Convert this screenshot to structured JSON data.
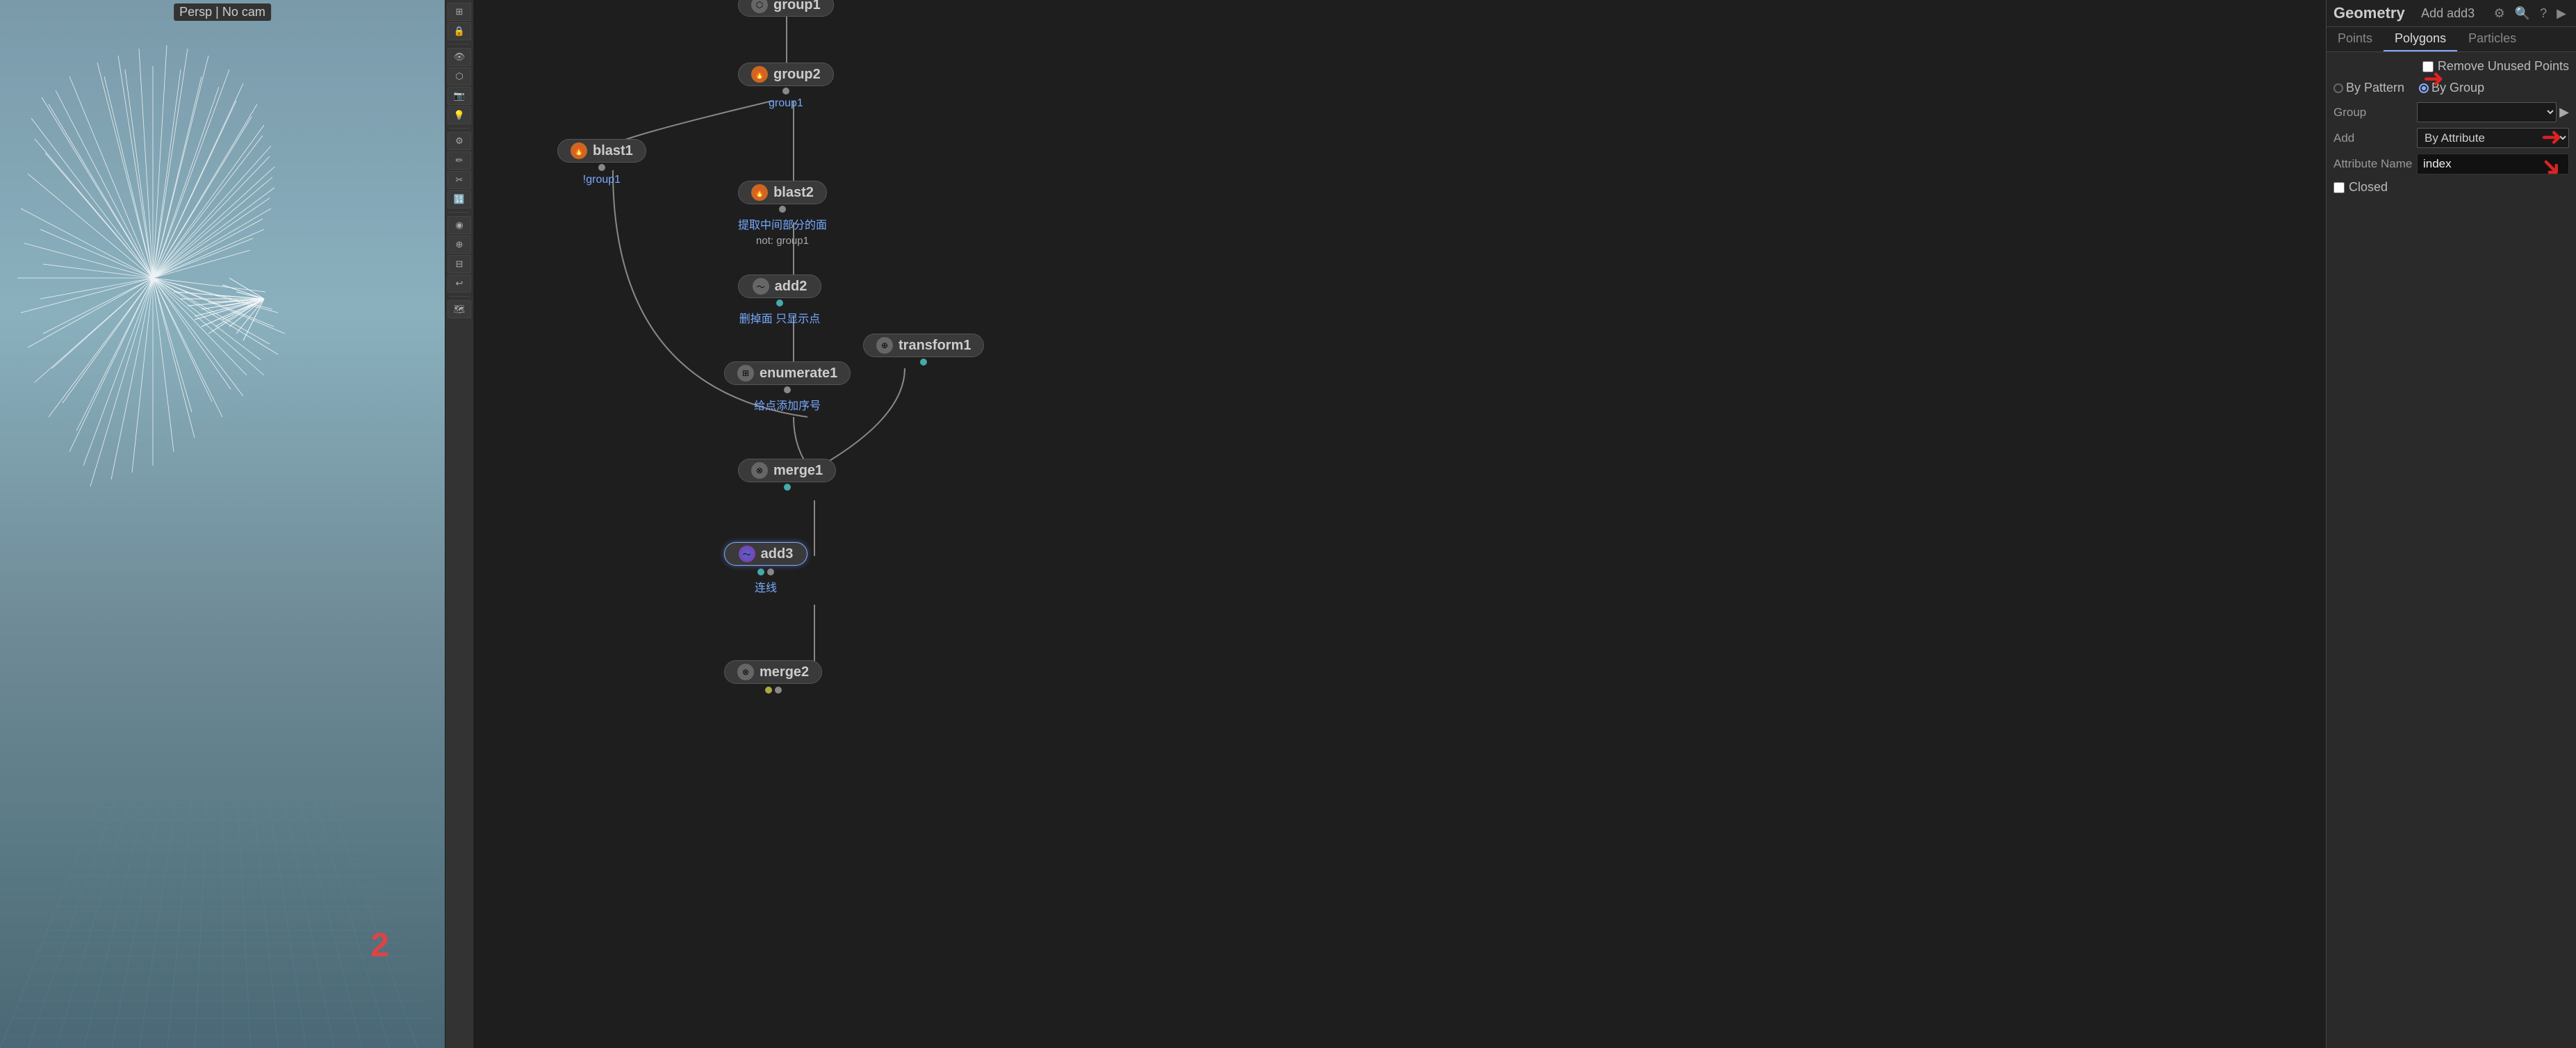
{
  "viewport": {
    "label": "Persp | No cam",
    "number": "2"
  },
  "toolbar": {
    "buttons": [
      {
        "icon": "⊞",
        "name": "layout-icon"
      },
      {
        "icon": "🔒",
        "name": "lock-icon"
      },
      {
        "icon": "👁",
        "name": "eye-icon"
      },
      {
        "icon": "⬡",
        "name": "geo-icon"
      },
      {
        "icon": "📷",
        "name": "cam-icon"
      },
      {
        "icon": "💡",
        "name": "light-icon"
      },
      {
        "icon": "⚙",
        "name": "settings-icon"
      },
      {
        "icon": "✏",
        "name": "edit-icon"
      },
      {
        "icon": "✂",
        "name": "cut-icon"
      },
      {
        "icon": "🔢",
        "name": "num-icon"
      },
      {
        "icon": "◉",
        "name": "dot-icon"
      },
      {
        "icon": "⊕",
        "name": "plus-icon"
      },
      {
        "icon": "⊟",
        "name": "minus-icon"
      },
      {
        "icon": "↩",
        "name": "undo-icon"
      },
      {
        "icon": "🗺",
        "name": "map-icon"
      }
    ]
  },
  "nodes": {
    "group1_top": {
      "label": "group1",
      "sublabel": "",
      "type": "gray"
    },
    "group2": {
      "label": "group2",
      "sublabel": "group1",
      "type": "orange"
    },
    "blast1": {
      "label": "blast1",
      "sublabel": "!group1",
      "type": "orange"
    },
    "blast2": {
      "label": "blast2",
      "sublabel": "提取中间部分的面",
      "type": "orange"
    },
    "add2": {
      "label": "add2",
      "sublabel": "删掉面 只显示点",
      "type": "gray"
    },
    "enumerate1": {
      "label": "enumerate1",
      "sublabel": "给点添加序号",
      "type": "gray"
    },
    "transform1": {
      "label": "transform1",
      "sublabel": "",
      "type": "gray"
    },
    "merge1": {
      "label": "merge1",
      "sublabel": "",
      "type": "gray"
    },
    "add3": {
      "label": "add3",
      "sublabel": "连线",
      "type": "blue-purple"
    },
    "merge2": {
      "label": "merge2",
      "sublabel": "",
      "type": "gray"
    }
  },
  "properties": {
    "title": "Geometry",
    "node_info": "Add  add3",
    "tabs": [
      "Points",
      "Polygons",
      "Particles"
    ],
    "active_tab": "Polygons",
    "remove_unused_points": false,
    "by_pattern_label": "By Pattern",
    "by_group_label": "By Group",
    "selected_mode": "by_group",
    "group_label": "Group",
    "group_value": "",
    "add_label": "Add",
    "add_value": "By Attribute",
    "attribute_name_label": "Attribute Name",
    "attribute_name_value": "index",
    "closed_label": "Closed",
    "closed_checked": false
  }
}
